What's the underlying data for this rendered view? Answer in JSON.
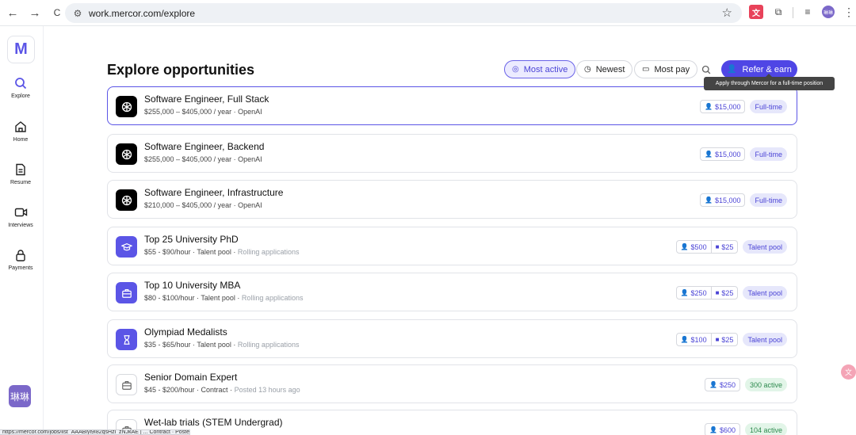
{
  "browser": {
    "back": "←",
    "forward": "→",
    "reload": "C",
    "url": "work.mercor.com/explore",
    "status_url": "https://mercor.com/jobs/list_AAABlyl9I82qsHzl_zNJkAE | ... Contract · Posted 2 months"
  },
  "sidebar": {
    "logo": "M",
    "items": [
      {
        "label": "Explore",
        "icon": "search-icon"
      },
      {
        "label": "Home",
        "icon": "home-icon"
      },
      {
        "label": "Resume",
        "icon": "document-icon"
      },
      {
        "label": "Interviews",
        "icon": "video-icon"
      },
      {
        "label": "Payments",
        "icon": "lock-icon"
      }
    ],
    "avatar": "琳琳"
  },
  "header": {
    "title": "Explore opportunities",
    "filters": [
      {
        "label": "Most active",
        "active": true
      },
      {
        "label": "Newest",
        "active": false
      },
      {
        "label": "Most pay",
        "active": false
      }
    ],
    "refer_label": "Refer & earn",
    "tooltip": "Apply through Mercor for a full-time position"
  },
  "jobs": [
    {
      "title": "Software Engineer, Full Stack",
      "sub": "$255,000 – $405,000 / year · OpenAI",
      "extra": "",
      "referral": "$15,000",
      "video": "",
      "tag": "Full-time",
      "tag_color": "purple"
    },
    {
      "title": "Software Engineer, Backend",
      "sub": "$255,000 – $405,000 / year · OpenAI",
      "extra": "",
      "referral": "$15,000",
      "video": "",
      "tag": "Full-time",
      "tag_color": "purple"
    },
    {
      "title": "Software Engineer, Infrastructure",
      "sub": "$210,000 – $405,000 / year · OpenAI",
      "extra": "",
      "referral": "$15,000",
      "video": "",
      "tag": "Full-time",
      "tag_color": "purple"
    },
    {
      "title": "Top 25 University PhD",
      "sub": "$55 - $90/hour · Talent pool · ",
      "extra": "Rolling applications",
      "referral": "$500",
      "video": "$25",
      "tag": "Talent pool",
      "tag_color": "purple"
    },
    {
      "title": "Top 10 University MBA",
      "sub": "$80 - $100/hour · Talent pool · ",
      "extra": "Rolling applications",
      "referral": "$250",
      "video": "$25",
      "tag": "Talent pool",
      "tag_color": "purple"
    },
    {
      "title": "Olympiad Medalists",
      "sub": "$35 - $65/hour · Talent pool · ",
      "extra": "Rolling applications",
      "referral": "$100",
      "video": "$25",
      "tag": "Talent pool",
      "tag_color": "purple"
    },
    {
      "title": "Senior Domain Expert",
      "sub": "$45 - $200/hour · Contract · ",
      "extra": "Posted 13 hours ago",
      "referral": "$250",
      "video": "",
      "tag": "300 active",
      "tag_color": "green"
    },
    {
      "title": "Wet-lab trials (STEM Undergrad)",
      "sub": "",
      "extra": "",
      "referral": "$600",
      "video": "",
      "tag": "104 active",
      "tag_color": "green"
    }
  ]
}
